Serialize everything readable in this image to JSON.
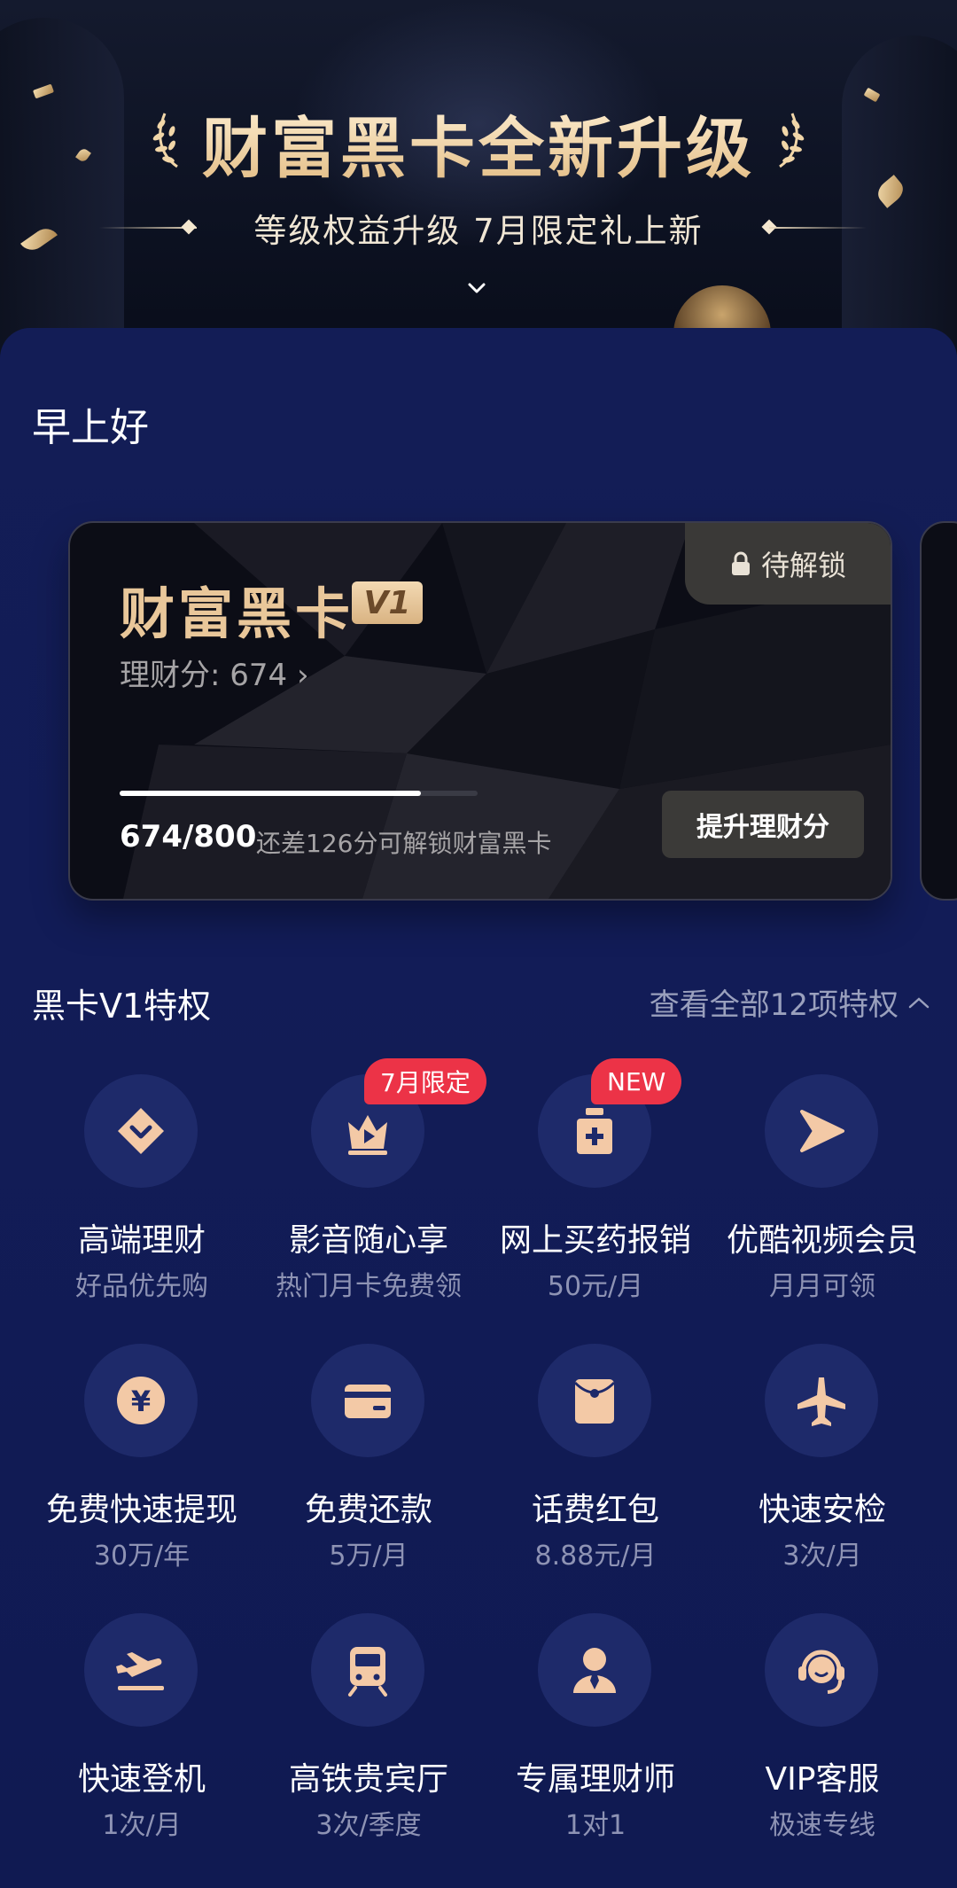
{
  "banner": {
    "title": "财富黑卡全新升级",
    "subtitle": "等级权益升级  7月限定礼上新"
  },
  "greeting": "早上好",
  "card": {
    "title": "财富黑卡",
    "level_badge": "V1",
    "lock_label": "待解锁",
    "score_text": "理财分: 674 ›",
    "progress_text": "674/800",
    "progress_fraction": 0.8425,
    "hint_text": "还差126分可解锁财富黑卡",
    "upgrade_button": "提升理财分"
  },
  "privileges": {
    "title": "黑卡V1特权",
    "see_all": "查看全部12项特权",
    "items": [
      {
        "label": "高端理财",
        "sub": "好品优先购",
        "icon": "diamond-icon",
        "tag": ""
      },
      {
        "label": "影音随心享",
        "sub": "热门月卡免费领",
        "icon": "crown-play-icon",
        "tag": "7月限定"
      },
      {
        "label": "网上买药报销",
        "sub": "50元/月",
        "icon": "medicine-bottle-icon",
        "tag": "NEW"
      },
      {
        "label": "优酷视频会员",
        "sub": "月月可领",
        "icon": "youku-icon",
        "tag": ""
      },
      {
        "label": "免费快速提现",
        "sub": "30万/年",
        "icon": "yen-coin-icon",
        "tag": ""
      },
      {
        "label": "免费还款",
        "sub": "5万/月",
        "icon": "credit-card-icon",
        "tag": ""
      },
      {
        "label": "话费红包",
        "sub": "8.88元/月",
        "icon": "red-envelope-icon",
        "tag": ""
      },
      {
        "label": "快速安检",
        "sub": "3次/月",
        "icon": "airplane-icon",
        "tag": ""
      },
      {
        "label": "快速登机",
        "sub": "1次/月",
        "icon": "takeoff-icon",
        "tag": ""
      },
      {
        "label": "高铁贵宾厅",
        "sub": "3次/季度",
        "icon": "train-icon",
        "tag": ""
      },
      {
        "label": "专属理财师",
        "sub": "1对1",
        "icon": "advisor-icon",
        "tag": ""
      },
      {
        "label": "VIP客服",
        "sub": "极速专线",
        "icon": "headset-icon",
        "tag": ""
      }
    ]
  },
  "colors": {
    "panel": "#131d56",
    "gold": "#e9c79a",
    "icon_fill": "#f3c9a6",
    "tag_red": "#ec3347"
  }
}
